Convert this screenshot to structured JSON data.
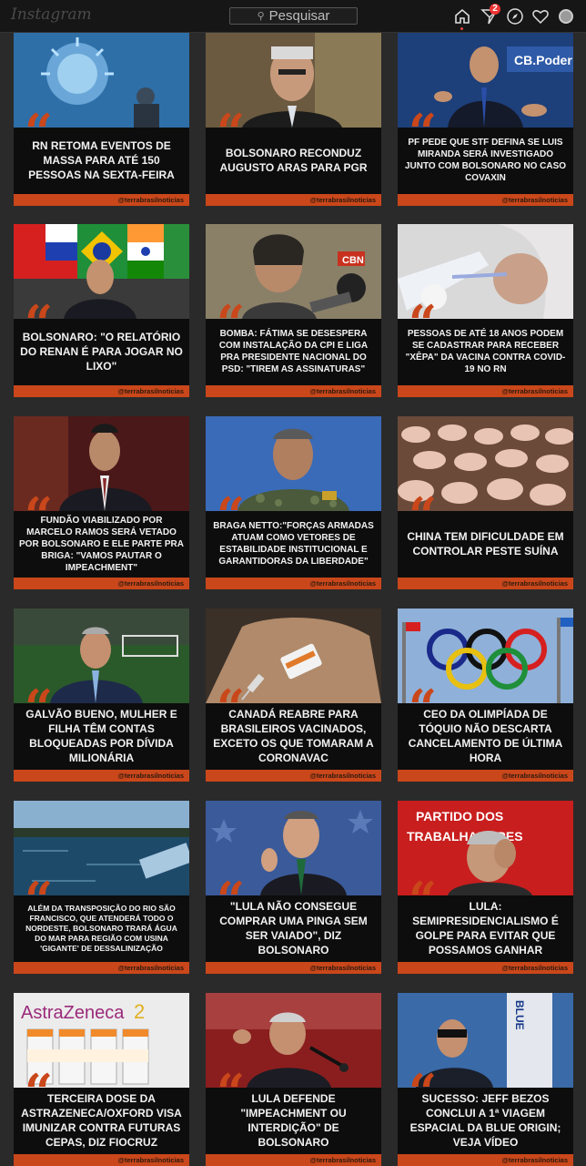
{
  "header": {
    "logo": "Instagram",
    "search_placeholder": "Pesquisar",
    "direct_badge": "2"
  },
  "icons": {
    "search": "search-icon",
    "home": "home-icon",
    "direct": "direct-message-icon",
    "explore": "compass-icon",
    "activity": "heart-icon",
    "profile": "avatar-icon"
  },
  "colors": {
    "accent": "#c9471a",
    "background": "#2a2a2a",
    "card": "#0d0d0d"
  },
  "posts": [
    {
      "headline": "RN retoma eventos de massa para até 150 pessoas na sexta-feira",
      "handle": "@terrabrasilnoticias",
      "image": "virus"
    },
    {
      "headline": "Bolsonaro reconduz Augusto Aras para PGR",
      "handle": "@terrabrasilnoticias",
      "image": "man-portrait"
    },
    {
      "headline": "PF pede que STF defina se Luis Miranda será investigado junto com Bolsonaro no caso Covaxin",
      "handle": "@terrabrasilnoticias",
      "image": "interview",
      "overlay": "CB.Poder"
    },
    {
      "headline": "Bolsonaro: \"O relatório do Renan é para jogar no lixo\"",
      "handle": "@terrabrasilnoticias",
      "image": "flags"
    },
    {
      "headline": "Bomba: Fátima se desespera com instalação da CPI e liga pra presidente nacional do PSD: \"Tirem as assinaturas\"",
      "handle": "@terrabrasilnoticias",
      "image": "woman-mics"
    },
    {
      "headline": "Pessoas de até 18 anos podem se cadastrar para receber \"xêpa\" da vacina contra Covid-19 no RN",
      "handle": "@terrabrasilnoticias",
      "image": "vaccination"
    },
    {
      "headline": "Fundão viabilizado por Marcelo Ramos será vetado por Bolsonaro e ele parte pra briga: \"vamos pautar o impeachment\"",
      "handle": "@terrabrasilnoticias",
      "image": "man-suit"
    },
    {
      "headline": "Braga Netto:\"Forças Armadas atuam como vetores de estabilidade institucional e garantidoras da liberdade\"",
      "handle": "@terrabrasilnoticias",
      "image": "military"
    },
    {
      "headline": "China tem dificuldade em controlar peste suína",
      "handle": "@terrabrasilnoticias",
      "image": "pigs"
    },
    {
      "headline": "Galvão Bueno, mulher e filha têm contas bloqueadas por dívida milionária",
      "handle": "@terrabrasilnoticias",
      "image": "stadium"
    },
    {
      "headline": "Canadá reabre para brasileiros vacinados, exceto os que tomaram a Coronavac",
      "handle": "@terrabrasilnoticias",
      "image": "vial"
    },
    {
      "headline": "CEO da Olimpíada de Tóquio não descarta cancelamento de última hora",
      "handle": "@terrabrasilnoticias",
      "image": "olympic-rings"
    },
    {
      "headline": "Além da transposição do Rio São Francisco, que atenderá todo o Nordeste, Bolsonaro trará água do mar para região com usina 'gigante' de dessalinização",
      "handle": "@terrabrasilnoticias",
      "image": "sea"
    },
    {
      "headline": "\"Lula não consegue comprar uma pinga sem ser vaiado\", diz Bolsonaro",
      "handle": "@terrabrasilnoticias",
      "image": "smiling-man"
    },
    {
      "headline": "Lula: semipresidencialismo é golpe para evitar que possamos ganhar",
      "handle": "@terrabrasilnoticias",
      "image": "banner-man",
      "overlay": "PARTIDO DOS TRABALHADORES"
    },
    {
      "headline": "Terceira dose da AstraZeneca/Oxford visa imunizar contra futuras cepas, diz Fiocruz",
      "handle": "@terrabrasilnoticias",
      "image": "vaccine-vials",
      "overlay": "AstraZeneca"
    },
    {
      "headline": "Lula defende \"impeachment ou interdição\" de Bolsonaro",
      "handle": "@terrabrasilnoticias",
      "image": "speaker"
    },
    {
      "headline": "Sucesso: Jeff Bezos conclui a 1ª viagem espacial da Blue Origin; veja vídeo",
      "handle": "@terrabrasilnoticias",
      "image": "rocket",
      "overlay": "BLUE"
    }
  ]
}
